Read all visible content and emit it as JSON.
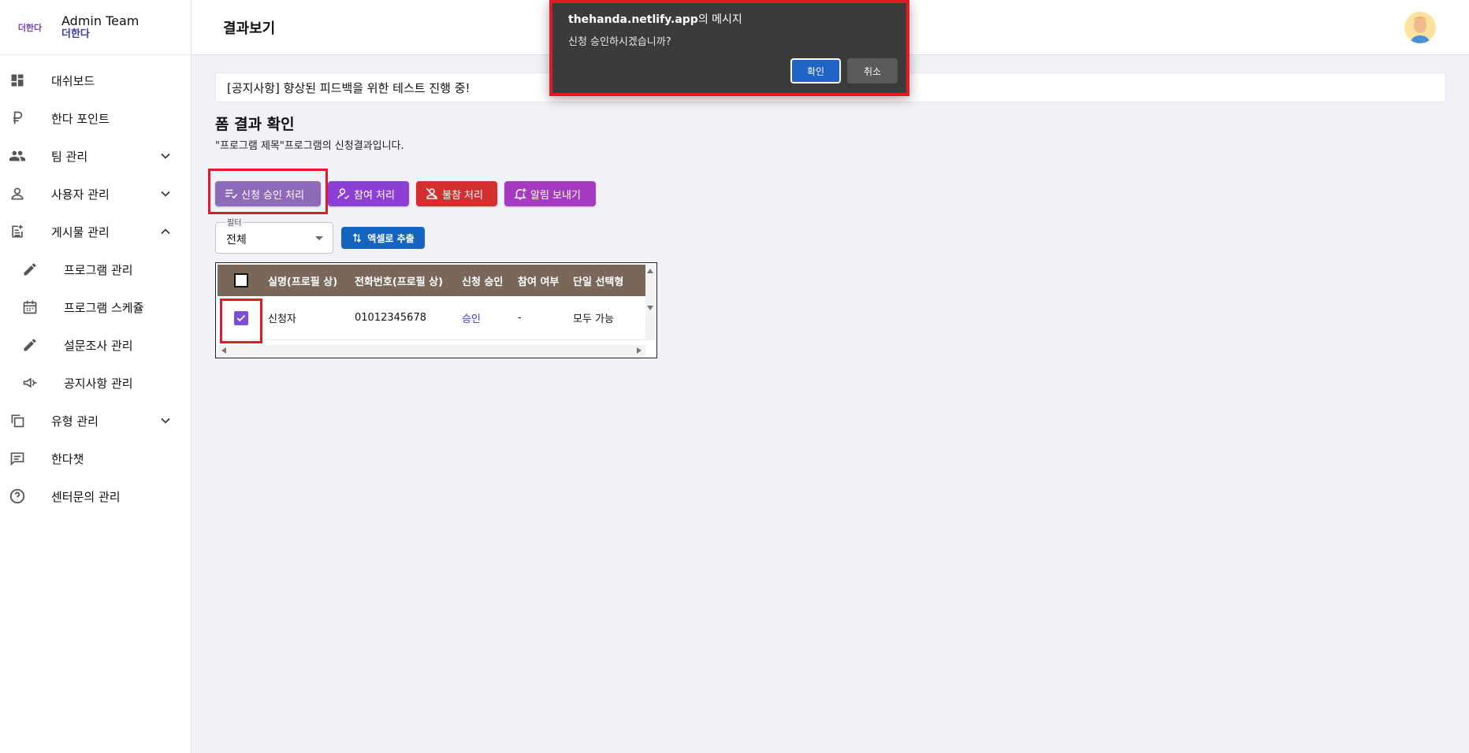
{
  "brand": {
    "logo_text": "더한다",
    "title": "Admin Team",
    "subtitle": "더한다"
  },
  "header": {
    "page_title": "결과보기"
  },
  "sidebar": {
    "items": [
      {
        "label": "대쉬보드",
        "icon": "dashboard-icon"
      },
      {
        "label": "한다 포인트",
        "icon": "ruble-icon"
      },
      {
        "label": "팀 관리",
        "icon": "group-icon",
        "expandable": true
      },
      {
        "label": "사용자 관리",
        "icon": "person-icon",
        "expandable": true
      },
      {
        "label": "게시물 관리",
        "icon": "post-add-icon",
        "expanded": true
      },
      {
        "label": "프로그램 관리",
        "icon": "pencil-icon",
        "sub": true
      },
      {
        "label": "프로그램 스케쥴",
        "icon": "calendar-icon",
        "sub": true
      },
      {
        "label": "설문조사 관리",
        "icon": "pencil-icon",
        "sub": true
      },
      {
        "label": "공지사항 관리",
        "icon": "megaphone-icon",
        "sub": true
      },
      {
        "label": "유형 관리",
        "icon": "copy-icon",
        "expandable": true
      },
      {
        "label": "한다챗",
        "icon": "chat-icon"
      },
      {
        "label": "센터문의 관리",
        "icon": "help-icon"
      }
    ]
  },
  "notice": {
    "text": "[공지사항] 향상된 피드백을 위한 테스트 진행 중!"
  },
  "form": {
    "title": "폼 결과 확인",
    "subtitle": "\"프로그램 제목\"프로그램의 신청결과입니다."
  },
  "actions": {
    "approve": "신청 승인 처리",
    "attend": "참여 처리",
    "absent": "불참 처리",
    "notify": "알림 보내기"
  },
  "filter": {
    "label": "필터",
    "value": "전체"
  },
  "excel": {
    "label": "엑셀로 추출"
  },
  "table": {
    "headers": [
      "실명(프로필 상)",
      "전화번호(프로필 상)",
      "신청 승인",
      "참여 여부",
      "단일 선택형"
    ],
    "rows": [
      {
        "checked": true,
        "name": "신청자",
        "phone": "01012345678",
        "approval": "승인",
        "attendance": "-",
        "single_choice": "모두 가능"
      }
    ]
  },
  "dialog": {
    "origin": "thehanda.netlify.app",
    "origin_suffix": "의 메시지",
    "message": "신청 승인하시겠습니까?",
    "ok": "확인",
    "cancel": "취소"
  },
  "colors": {
    "accent": "#7d4fd6",
    "danger": "#d32f2f",
    "primary": "#1565c0",
    "highlight": "#e01b24",
    "table_header": "#79685a"
  }
}
